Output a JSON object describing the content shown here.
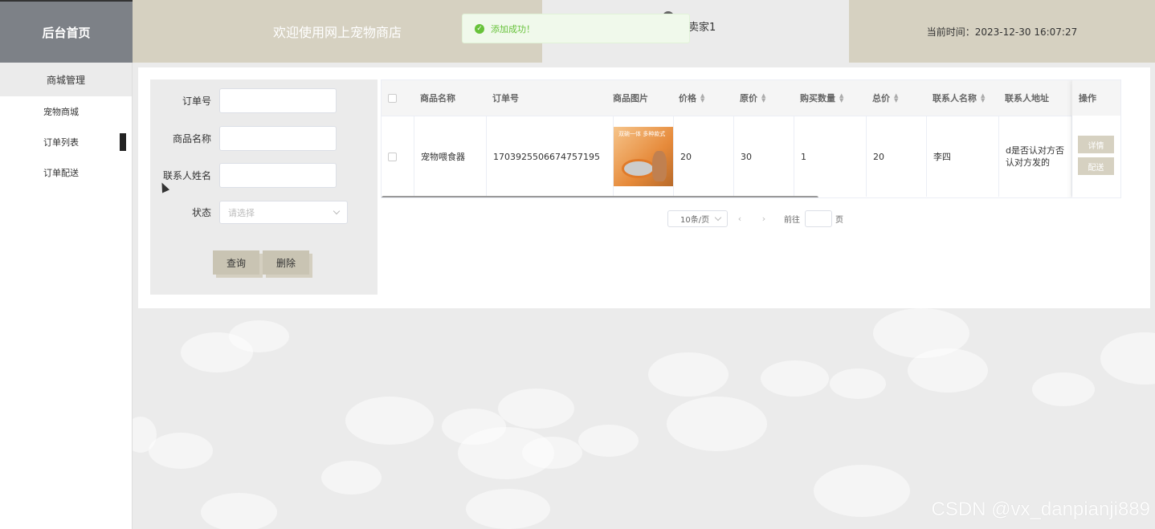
{
  "header": {
    "brand": "后台首页",
    "welcome": "欢迎使用网上宠物商店",
    "user_name": "卖家1",
    "current_time": "当前时间：2023-12-30 16:07:27"
  },
  "toast": {
    "message": "添加成功！",
    "icon": "check-icon",
    "color": "#67c23a"
  },
  "sidebar": {
    "group": "商城管理",
    "items": [
      {
        "label": "宠物商城"
      },
      {
        "label": "订单列表"
      },
      {
        "label": "订单配送"
      }
    ]
  },
  "filter": {
    "order_no_label": "订单号",
    "order_no_value": "",
    "product_label": "商品名称",
    "product_value": "",
    "contact_label": "联系人姓名",
    "contact_value": "",
    "status_label": "状态",
    "status_placeholder": "请选择",
    "query_button": "查询",
    "delete_button": "删除"
  },
  "table": {
    "headers": {
      "name": "商品名称",
      "order_no": "订单号",
      "image": "商品图片",
      "price": "价格",
      "orig_price": "原价",
      "qty": "购买数量",
      "total": "总价",
      "contact_name": "联系人名称",
      "address": "联系人地址",
      "ops": "操作"
    },
    "rows": [
      {
        "name": "宠物喂食器",
        "order_no": "1703925506674757195",
        "image_caption": "双碗一体 多种款式",
        "price": "20",
        "orig_price": "30",
        "qty": "1",
        "total": "20",
        "contact_name": "李四",
        "address": "d是否认对方否认对方发的",
        "detail_button": "详情",
        "ship_button": "配送"
      }
    ]
  },
  "pager": {
    "page_size": "10条/页",
    "prev": "‹",
    "next": "›",
    "goto_label": "前往",
    "page_suffix": "页"
  },
  "watermark": "CSDN @vx_danpianji889",
  "colors": {
    "accent": "#d6d1c1",
    "sidebar_header": "#7d8187",
    "success": "#67c23a"
  }
}
